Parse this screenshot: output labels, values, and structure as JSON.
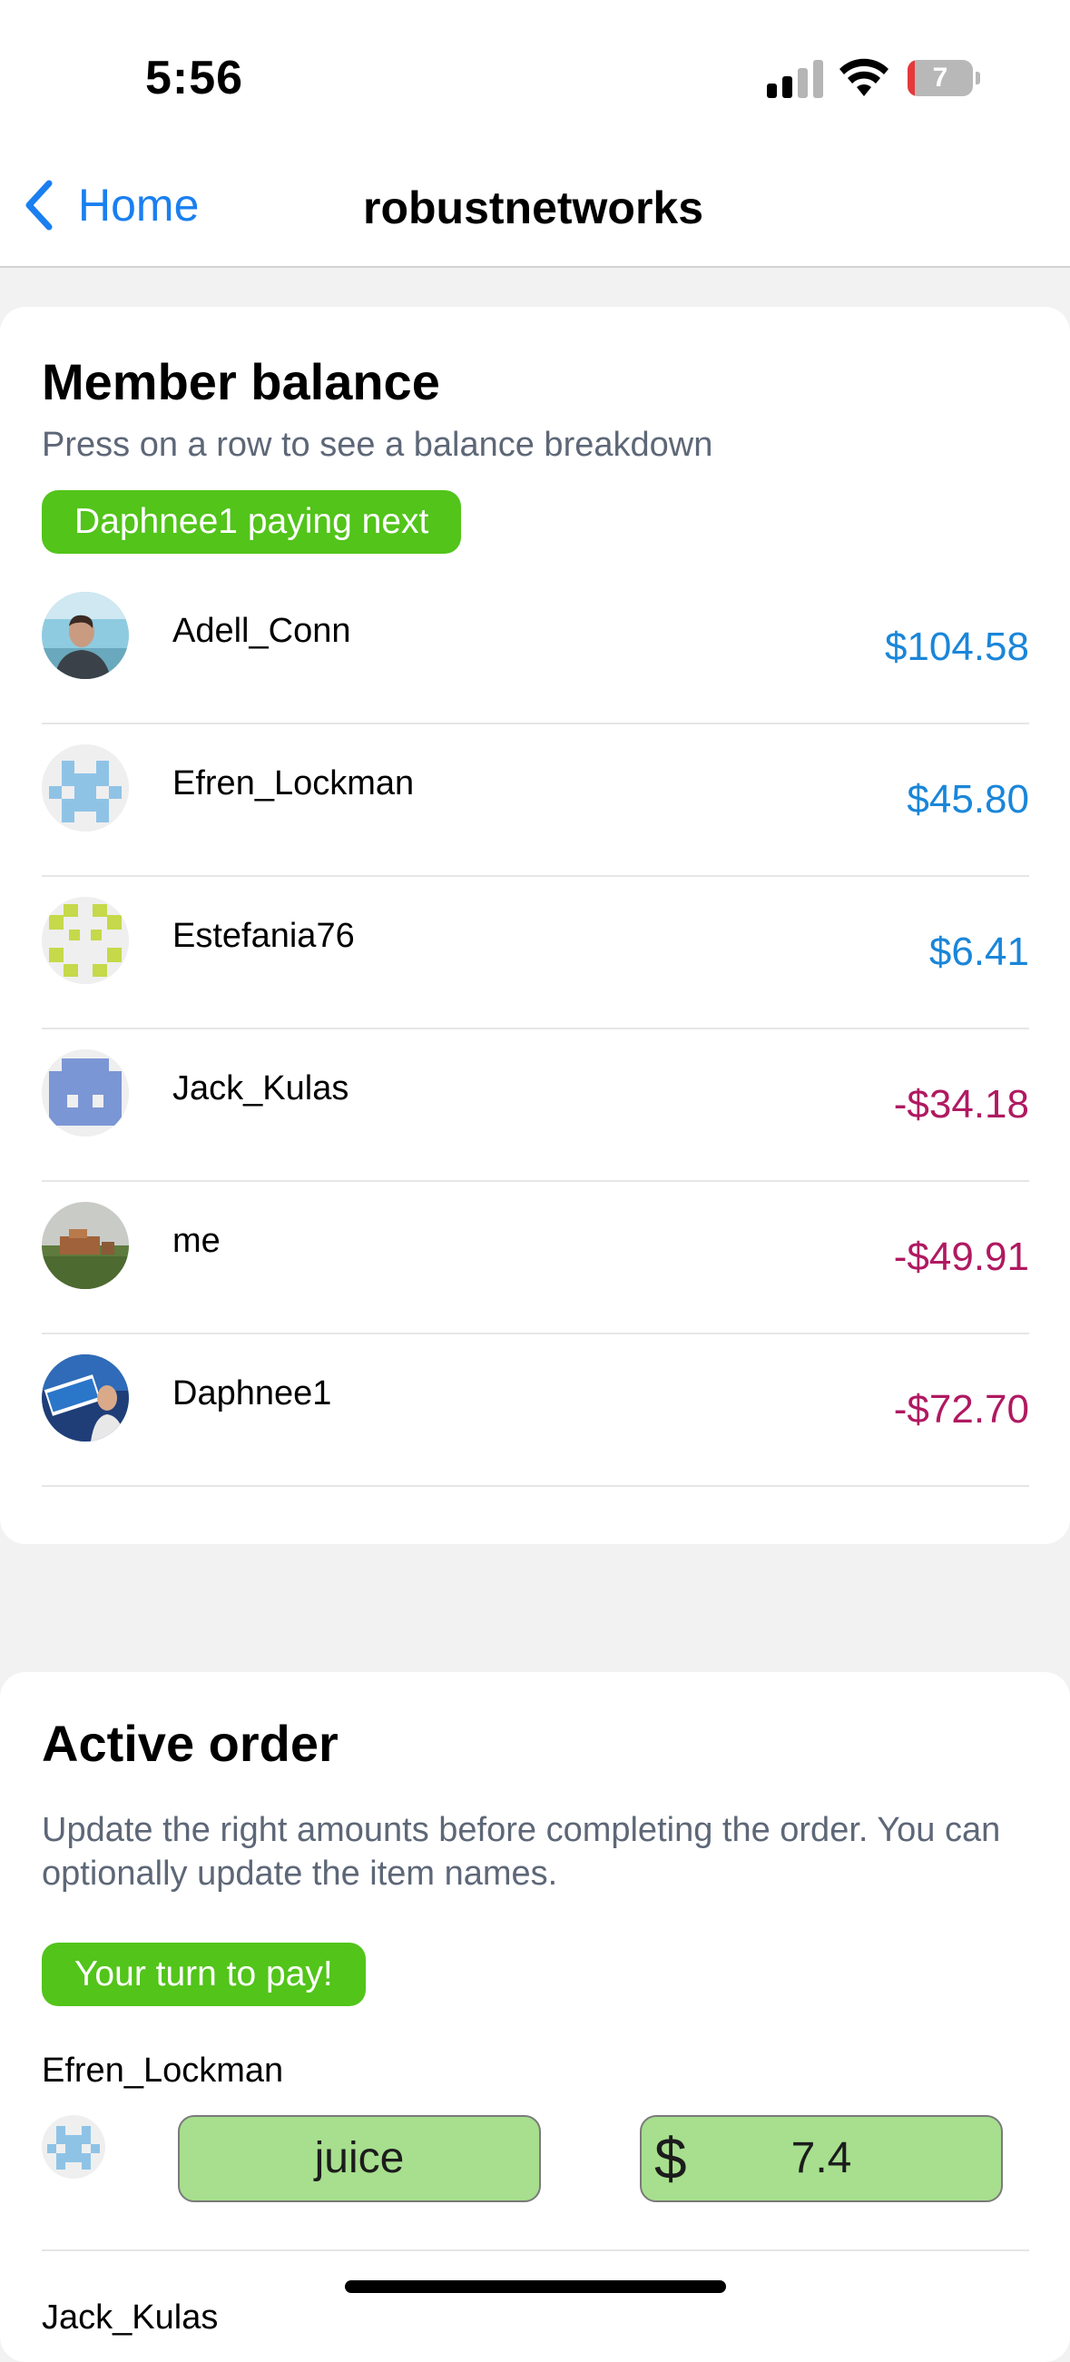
{
  "status_bar": {
    "time": "5:56",
    "battery": "7"
  },
  "nav": {
    "back_label": "Home",
    "title": "robustnetworks"
  },
  "balance": {
    "title": "Member balance",
    "subtitle": "Press on a row to see a balance breakdown",
    "next_payer": "Daphnee1 paying next",
    "members": [
      {
        "name": "Adell_Conn",
        "amount": "$104.58"
      },
      {
        "name": "Efren_Lockman",
        "amount": "$45.80"
      },
      {
        "name": "Estefania76",
        "amount": "$6.41"
      },
      {
        "name": "Jack_Kulas",
        "amount": "-$34.18"
      },
      {
        "name": "me",
        "amount": "-$49.91"
      },
      {
        "name": "Daphnee1",
        "amount": "-$72.70"
      }
    ]
  },
  "order": {
    "title": "Active order",
    "subtitle": "Update the right amounts before completing the order. You can optionally update the item names.",
    "turn_badge": "Your turn to pay!",
    "entries": [
      {
        "user": "Efren_Lockman",
        "item": "juice",
        "currency": "$",
        "price": "7.4"
      },
      {
        "user": "Jack_Kulas"
      }
    ]
  },
  "colors": {
    "accent": "#1a7ff0",
    "positive": "#1a86d9",
    "negative": "#b01961",
    "badge": "#52c41a",
    "field": "#a7df8e"
  }
}
